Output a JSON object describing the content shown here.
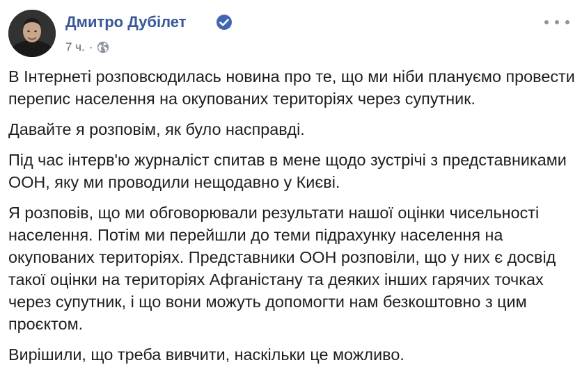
{
  "author": {
    "name": "Дмитро Дубілет",
    "verified": true,
    "avatar_icon": "person-portrait"
  },
  "meta": {
    "timestamp": "7 ч.",
    "separator": "·",
    "audience_icon": "globe-icon"
  },
  "menu": {
    "icon": "more-options-icon"
  },
  "post": {
    "paragraphs": [
      "В Інтернеті розповсюдилась новина про те, що ми ніби плануємо провести перепис населення на окупованих територіях через супутник.",
      "Давайте я розповім, як було насправді.",
      "Під час інтерв'ю журналіст спитав в мене щодо зустрічі з представниками ООН, яку ми проводили нещодавно у Києві.",
      "Я розповів, що ми обговорювали результати нашої оцінки чисельності населення. Потім ми перейшли до теми підрахунку населення на окупованих територіях. Представники ООН розповіли, що у них є досвід такої оцінки на територіях Афганістану та деяких інших гарячих точках через супутник, і що вони можуть допомогти нам безкоштовно з цим проєктом.",
      "Вирішили, що треба вивчити, наскільки це можливо."
    ]
  },
  "colors": {
    "link": "#385898",
    "verified": "#4267b2",
    "meta": "#606770",
    "text": "#1c1e21"
  }
}
